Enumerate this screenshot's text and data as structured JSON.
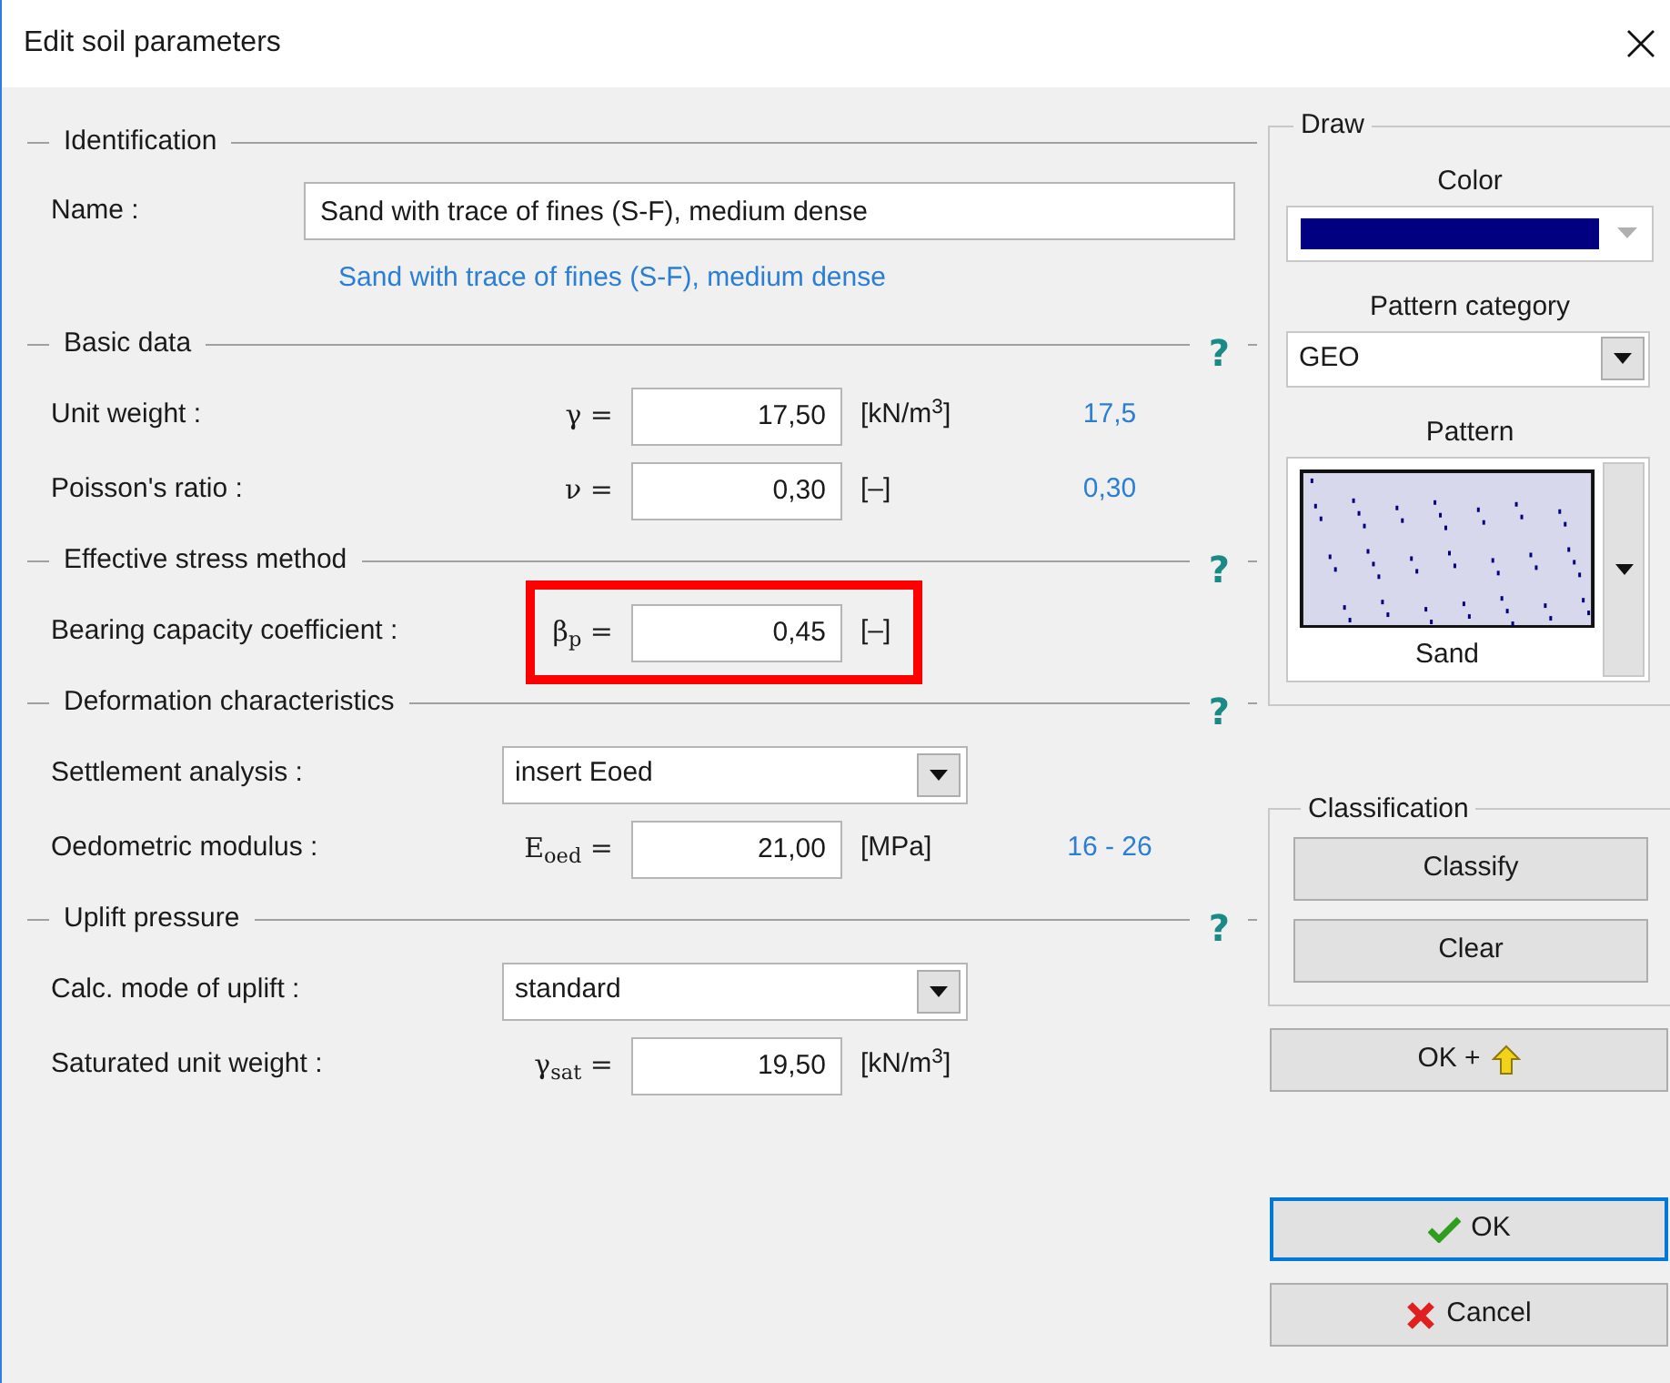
{
  "window": {
    "title": "Edit soil parameters"
  },
  "sections": [
    {
      "title": "Identification",
      "rows": [
        {
          "kind": "text",
          "label": "Name :",
          "value": "Sand with trace of fines (S-F), medium dense",
          "echo": "Sand with trace of fines (S-F), medium dense"
        }
      ]
    },
    {
      "title": "Basic data",
      "help": "?",
      "rows": [
        {
          "kind": "number",
          "label": "Unit weight :",
          "symbol": "γ =",
          "value": "17,50",
          "unit": "[kN/m$^{3}$]",
          "hint": "17,5",
          "highlighted": false
        },
        {
          "kind": "number",
          "label": "Poisson's ratio :",
          "symbol": "ν =",
          "value": "0,30",
          "unit": "[–]",
          "hint": "0,30",
          "highlighted": false
        }
      ]
    },
    {
      "title": "Effective stress method",
      "help": "?",
      "rows": [
        {
          "kind": "number",
          "label": "Bearing capacity coefficient :",
          "symbol": "β$_{p}$ =",
          "value": "0,45",
          "unit": "[–]",
          "highlighted": true
        }
      ]
    },
    {
      "title": "Deformation characteristics",
      "help": "?",
      "rows": [
        {
          "kind": "select",
          "label": "Settlement analysis :",
          "value": "insert Eoed"
        },
        {
          "kind": "number",
          "label": "Oedometric modulus :",
          "symbol": "E$_{oed}$ =",
          "value": "21,00",
          "unit": "[MPa]",
          "hint": "16 - 26",
          "highlighted": false
        }
      ]
    },
    {
      "title": "Uplift pressure",
      "help": "?",
      "rows": [
        {
          "kind": "select",
          "label": "Calc. mode of uplift :",
          "value": "standard"
        },
        {
          "kind": "number",
          "label": "Saturated unit weight :",
          "symbol": "γ$_{sat}$ =",
          "value": "19,50",
          "unit": "[kN/m$^{3}$]",
          "highlighted": false
        }
      ]
    }
  ],
  "draw": {
    "title": "Draw",
    "color_label": "Color",
    "color": "#000080",
    "category_label": "Pattern category",
    "category": "GEO",
    "pattern_label": "Pattern",
    "pattern": "Sand"
  },
  "classification": {
    "title": "Classification",
    "buttons": [
      "Classify",
      "Clear"
    ]
  },
  "buttons": [
    {
      "kind": "ok-plus",
      "label": "OK +",
      "focused": false
    },
    {
      "kind": "ok",
      "label": "OK",
      "focused": true
    },
    {
      "kind": "cancel",
      "label": "Cancel",
      "focused": false
    }
  ]
}
